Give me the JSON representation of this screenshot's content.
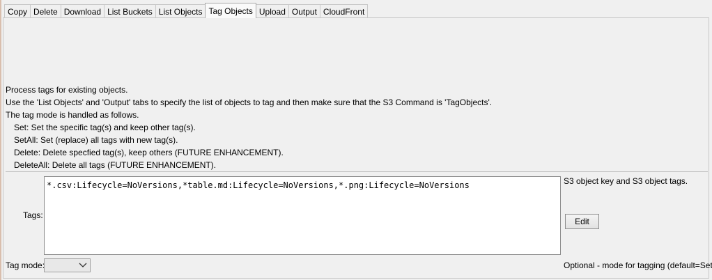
{
  "tabs": [
    {
      "label": "Copy",
      "active": false
    },
    {
      "label": "Delete",
      "active": false
    },
    {
      "label": "Download",
      "active": false
    },
    {
      "label": "List Buckets",
      "active": false
    },
    {
      "label": "List Objects",
      "active": false
    },
    {
      "label": "Tag Objects",
      "active": true
    },
    {
      "label": "Upload",
      "active": false
    },
    {
      "label": "Output",
      "active": false
    },
    {
      "label": "CloudFront",
      "active": false
    }
  ],
  "description": {
    "lines": [
      "Process tags for existing objects.",
      "Use the 'List Objects' and 'Output' tabs to specify the list of objects to tag and then make sure that the S3 Command is 'TagObjects'.",
      "The tag mode is handled as follows."
    ],
    "modes": [
      "Set: Set the specific tag(s) and keep other tag(s).",
      "SetAll: Set (replace) all tags with new tag(s).",
      "Delete: Delete specfied tag(s), keep others (FUTURE ENHANCEMENT).",
      "DeleteAll: Delete all tags (FUTURE ENHANCEMENT)."
    ]
  },
  "tags": {
    "label": "Tags:",
    "value": "*.csv:Lifecycle=NoVersions,*table.md:Lifecycle=NoVersions,*.png:Lifecycle=NoVersions",
    "note": "S3 object key and S3 object tags.",
    "edit_label": "Edit"
  },
  "tag_mode": {
    "label": "Tag mode:",
    "value": "",
    "note": "Optional - mode for tagging (default=Set)."
  },
  "icons": {
    "dropdown": "chevron-down-icon"
  }
}
